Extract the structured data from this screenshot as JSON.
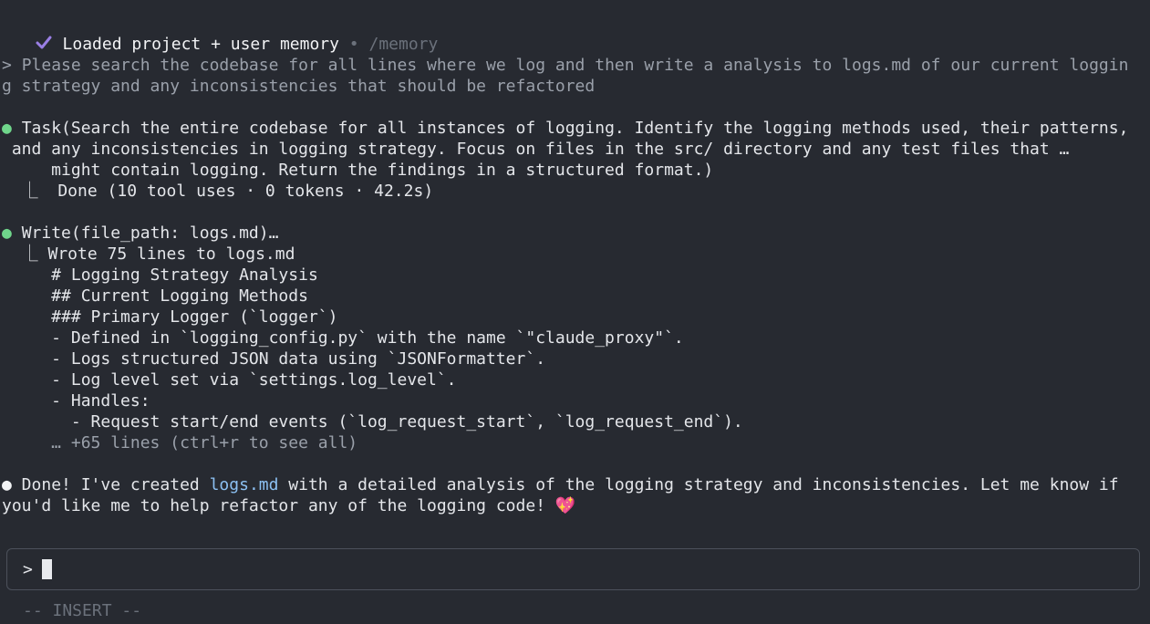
{
  "status": {
    "icon": "check-icon",
    "text": "Loaded project + user memory",
    "separator": " • ",
    "command": "/memory"
  },
  "user_prompt": {
    "marker": "> ",
    "lines": [
      "Please search the codebase for all lines where we log and then write a analysis to logs.md of our current loggin",
      "g strategy and any inconsistencies that should be refactored"
    ]
  },
  "task_tool": {
    "bullet": "●",
    "lines": [
      "Task(Search the entire codebase for all instances of logging. Identify the logging methods used, their patterns,",
      " and any inconsistencies in logging strategy. Focus on files in the src/ directory and any test files that …",
      "     might contain logging. Return the findings in a structured format.)"
    ],
    "result": "  ⎿  Done (10 tool uses · 0 tokens · 42.2s)"
  },
  "write_tool": {
    "bullet": "●",
    "title": "Write(file_path: logs.md)…",
    "result": "  ⎿ Wrote 75 lines to logs.md",
    "preview": [
      "     # Logging Strategy Analysis",
      "     ## Current Logging Methods",
      "     ### Primary Logger (`logger`)",
      "     - Defined in `logging_config.py` with the name `\"claude_proxy\"`.",
      "     - Logs structured JSON data using `JSONFormatter`.",
      "     - Log level set via `settings.log_level`.",
      "     - Handles:",
      "       - Request start/end events (`log_request_start`, `log_request_end`)."
    ],
    "more": "     … +65 lines (ctrl+r to see all)"
  },
  "assistant_reply": {
    "bullet": "●",
    "prefix": " Done! I've created ",
    "link": "logs.md",
    "suffix": " with a detailed analysis of the logging strategy and inconsistencies. Let me know if",
    "line2": "you'd like me to help refactor any of the logging code! ",
    "emoji": "💖"
  },
  "input": {
    "prompt": ">",
    "value": ""
  },
  "mode": "-- INSERT --",
  "colors": {
    "background": "#272a31",
    "text": "#e4e6ea",
    "dim": "#9aa0aa",
    "bullet_green": "#6fd68b",
    "link": "#8cc0f2",
    "check": "#9a7fe4"
  }
}
